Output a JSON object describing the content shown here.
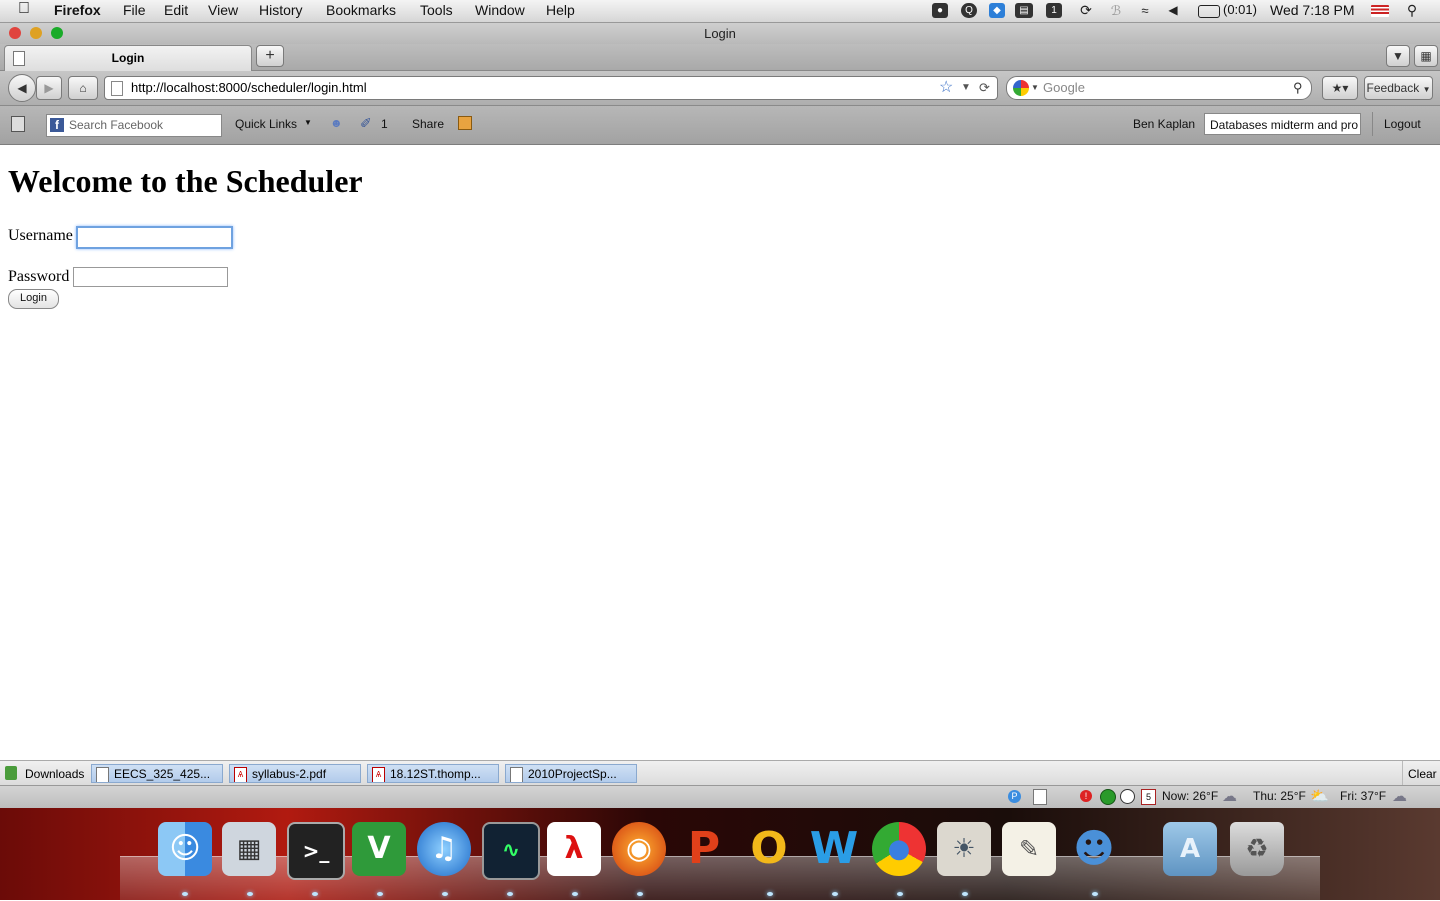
{
  "menubar": {
    "app": "Firefox",
    "items": [
      "File",
      "Edit",
      "View",
      "History",
      "Bookmarks",
      "Tools",
      "Window",
      "Help"
    ],
    "battery": "(0:01)",
    "clock": "Wed 7:18 PM"
  },
  "window": {
    "title": "Login"
  },
  "tabs": [
    {
      "label": "Login"
    }
  ],
  "new_tab_label": "+",
  "navbar": {
    "url": "http://localhost:8000/scheduler/login.html",
    "search_placeholder": "Google",
    "feedback_label": "Feedback"
  },
  "facebook_toolbar": {
    "search_placeholder": "Search Facebook",
    "quick_links": "Quick Links",
    "notifications_count": "1",
    "share": "Share",
    "user_name": "Ben Kaplan",
    "status_text": "Databases midterm and pro",
    "logout": "Logout"
  },
  "page": {
    "heading": "Welcome to the Scheduler",
    "username_label": "Username",
    "password_label": "Password",
    "login_button": "Login"
  },
  "downloads": {
    "label": "Downloads",
    "items": [
      "EECS_325_425...",
      "syllabus-2.pdf",
      "18.12ST.thomp...",
      "2010ProjectSp..."
    ],
    "clear_label": "Clear"
  },
  "statusbar": {
    "weather_now": "Now: 26°F",
    "weather_thu": "Thu: 25°F",
    "weather_fri": "Fri: 37°F"
  },
  "dock": {
    "icons": [
      "finder-icon",
      "dashboard-icon",
      "terminal-icon",
      "vim-icon",
      "itunes-icon",
      "activity-monitor-icon",
      "acrobat-icon",
      "firefox-icon",
      "powerpoint-icon",
      "outlook-icon",
      "word-icon",
      "chrome-icon",
      "iphoto-icon",
      "textedit-icon",
      "adium-icon",
      "applications-folder-icon",
      "trash-icon"
    ]
  },
  "colors": {
    "focus_ring": "#6fa2e0",
    "download_item": "#c0d5ef"
  }
}
